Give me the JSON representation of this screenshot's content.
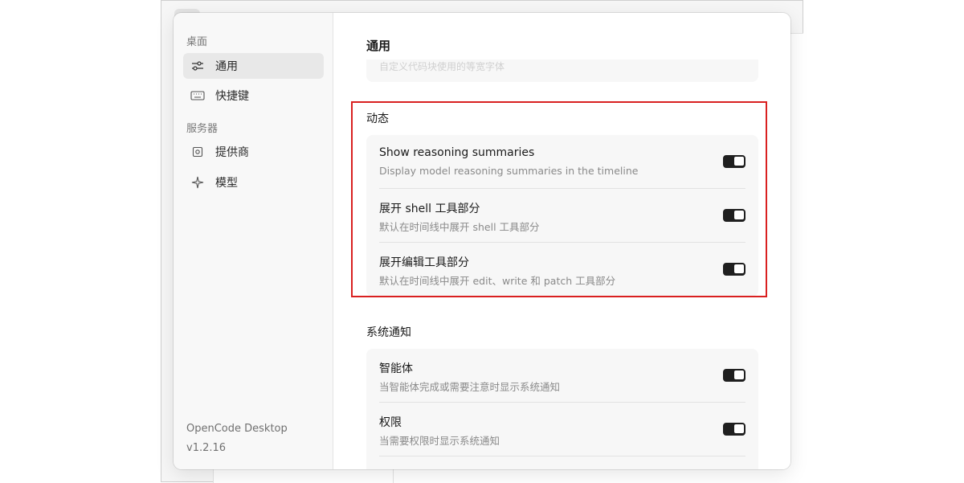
{
  "sidebar": {
    "group_desktop": "桌面",
    "group_server": "服务器",
    "items": [
      {
        "label": "通用",
        "icon": "sliders-icon"
      },
      {
        "label": "快捷键",
        "icon": "keyboard-icon"
      },
      {
        "label": "提供商",
        "icon": "chip-icon"
      },
      {
        "label": "模型",
        "icon": "sparkle-icon"
      }
    ],
    "app_name": "OpenCode Desktop",
    "version": "v1.2.16"
  },
  "main": {
    "title": "通用",
    "faded_text": "自定义代码块使用的等宽字体",
    "sections": [
      {
        "title": "动态",
        "rows": [
          {
            "title": "Show reasoning summaries",
            "desc": "Display model reasoning summaries in the timeline"
          },
          {
            "title": "展开 shell 工具部分",
            "desc": "默认在时间线中展开 shell 工具部分"
          },
          {
            "title": "展开编辑工具部分",
            "desc": "默认在时间线中展开 edit、write 和 patch 工具部分"
          }
        ]
      },
      {
        "title": "系统通知",
        "rows": [
          {
            "title": "智能体",
            "desc": "当智能体完成或需要注意时显示系统通知"
          },
          {
            "title": "权限",
            "desc": "当需要权限时显示系统通知"
          }
        ]
      }
    ]
  },
  "colors": {
    "highlight": "#d92020",
    "toggle_on": "#1f1f1f"
  }
}
